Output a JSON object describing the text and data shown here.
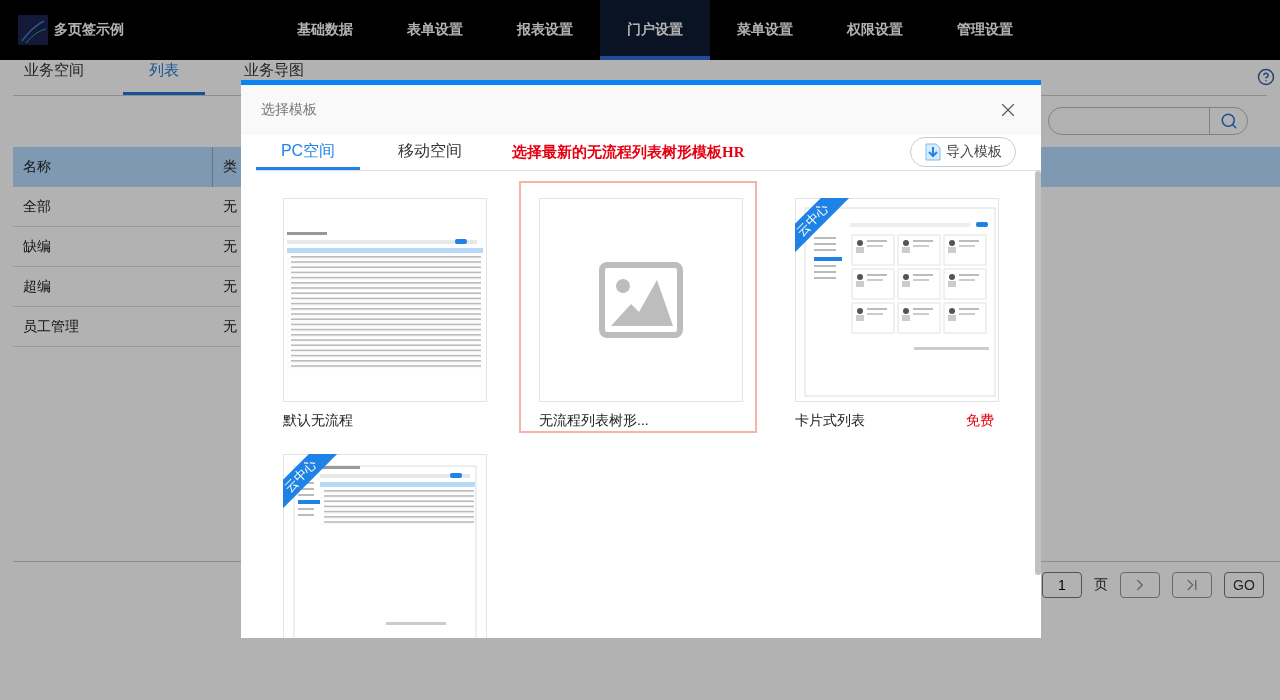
{
  "app": {
    "title": "多页签示例"
  },
  "nav": [
    {
      "label": "基础数据",
      "selected": false
    },
    {
      "label": "表单设置",
      "selected": false
    },
    {
      "label": "报表设置",
      "selected": false
    },
    {
      "label": "门户设置",
      "selected": true
    },
    {
      "label": "菜单设置",
      "selected": false
    },
    {
      "label": "权限设置",
      "selected": false
    },
    {
      "label": "管理设置",
      "selected": false
    }
  ],
  "subtabs": [
    {
      "label": "业务空间",
      "selected": false
    },
    {
      "label": "列表",
      "selected": true
    },
    {
      "label": "业务导图",
      "selected": false
    }
  ],
  "table": {
    "columns": [
      "名称",
      "类"
    ],
    "rows": [
      [
        "全部",
        "无"
      ],
      [
        "缺编",
        "无"
      ],
      [
        "超编",
        "无"
      ],
      [
        "员工管理",
        "无"
      ]
    ]
  },
  "pagination": {
    "page": "1",
    "page_label": "页",
    "go": "GO"
  },
  "dialog": {
    "title": "选择模板",
    "tabs": [
      {
        "label": "PC空间",
        "selected": true
      },
      {
        "label": "移动空间",
        "selected": false
      }
    ],
    "note": "选择最新的无流程列表树形模板HR",
    "import_button": "导入模板",
    "templates": [
      {
        "kind": "table",
        "name": "默认无流程",
        "selected": false
      },
      {
        "kind": "placeholder",
        "name": "无流程列表树形...",
        "selected": true
      },
      {
        "kind": "cards",
        "name": "卡片式列表",
        "price": "免费",
        "ribbon": "云中心",
        "selected": false
      },
      {
        "kind": "tree",
        "ribbon": "云中心",
        "selected": false
      }
    ]
  }
}
